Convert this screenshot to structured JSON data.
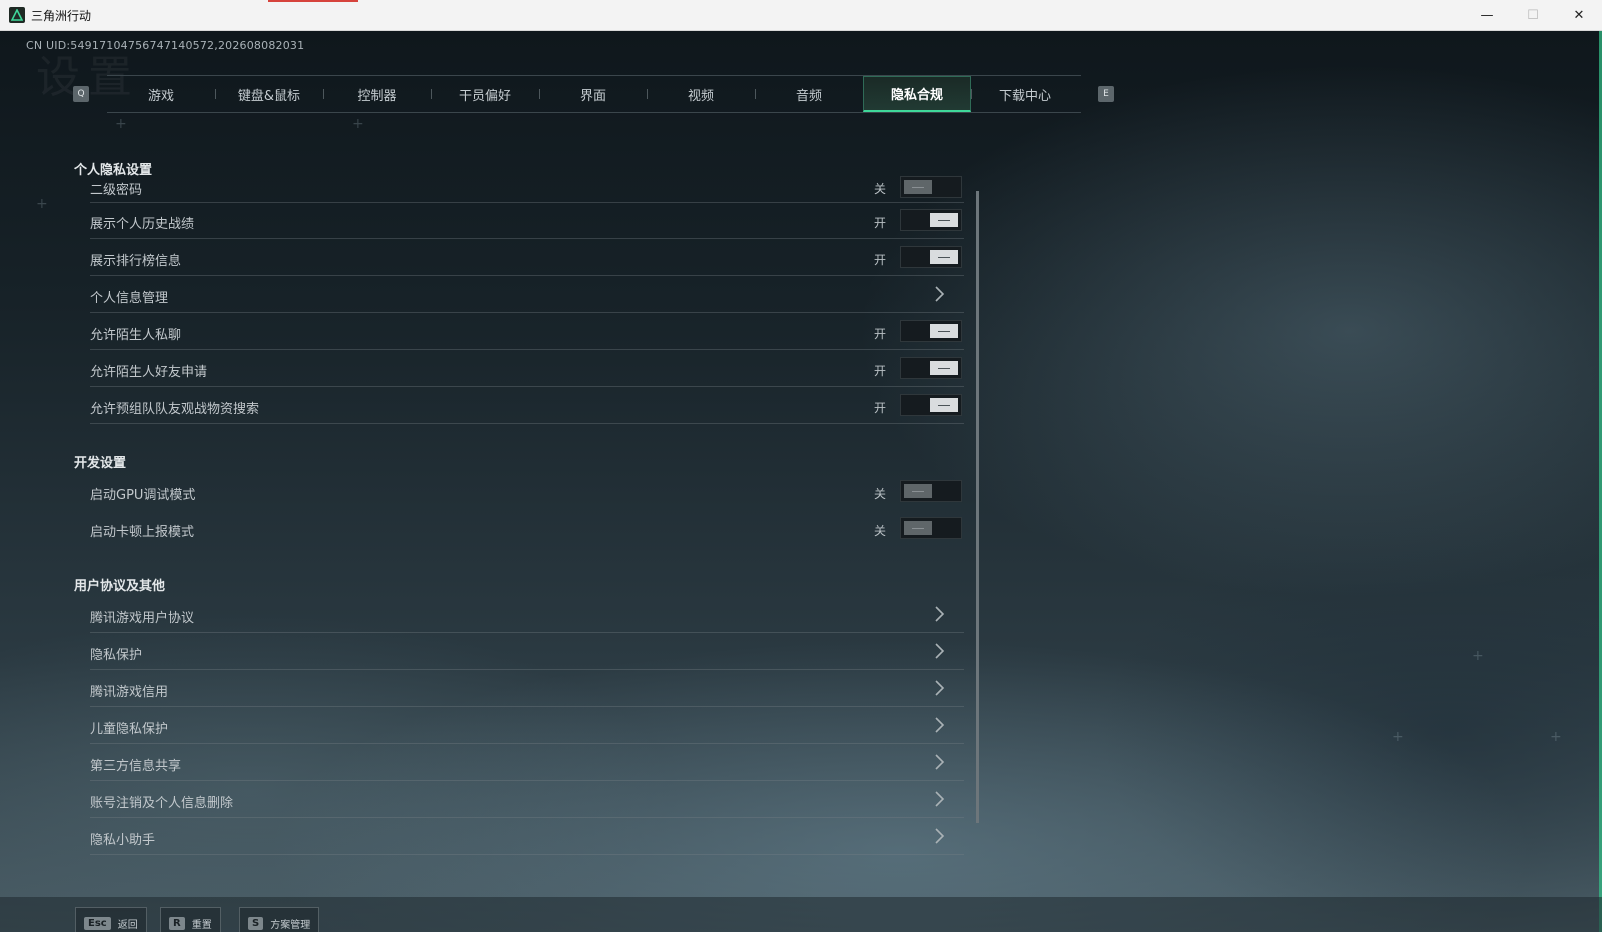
{
  "window": {
    "title": "三角洲行动",
    "minimize_glyph": "—",
    "maximize_glyph": "☐",
    "close_glyph": "✕",
    "icon": "delta-logo-icon"
  },
  "uid": "CN UID:54917104756747140572,202608082031",
  "watermark": "设置",
  "tabs": {
    "prev_key": "Q",
    "next_key": "E",
    "items": [
      {
        "label": "游戏"
      },
      {
        "label": "键盘&鼠标"
      },
      {
        "label": "控制器"
      },
      {
        "label": "干员偏好"
      },
      {
        "label": "界面"
      },
      {
        "label": "视频"
      },
      {
        "label": "音频"
      },
      {
        "label": "隐私合规"
      },
      {
        "label": "下载中心"
      }
    ],
    "active_index": 7
  },
  "sections": {
    "privacy": {
      "title": "个人隐私设置",
      "rows": [
        {
          "label": "二级密码",
          "state": "关",
          "on": false
        },
        {
          "label": "展示个人历史战绩",
          "state": "开",
          "on": true
        },
        {
          "label": "展示排行榜信息",
          "state": "开",
          "on": true
        },
        {
          "label": "个人信息管理",
          "link": true
        },
        {
          "label": "允许陌生人私聊",
          "state": "开",
          "on": true
        },
        {
          "label": "允许陌生人好友申请",
          "state": "开",
          "on": true
        },
        {
          "label": "允许预组队队友观战物资搜索",
          "state": "开",
          "on": true
        }
      ]
    },
    "dev": {
      "title": "开发设置",
      "rows": [
        {
          "label": "启动GPU调试模式",
          "state": "关",
          "on": false
        },
        {
          "label": "启动卡顿上报模式",
          "state": "关",
          "on": false
        }
      ]
    },
    "agreements": {
      "title": "用户协议及其他",
      "rows": [
        {
          "label": "腾讯游戏用户协议",
          "link": true
        },
        {
          "label": "隐私保护",
          "link": true
        },
        {
          "label": "腾讯游戏信用",
          "link": true
        },
        {
          "label": "儿童隐私保护",
          "link": true
        },
        {
          "label": "第三方信息共享",
          "link": true
        },
        {
          "label": "账号注销及个人信息删除",
          "link": true
        },
        {
          "label": "隐私小助手",
          "link": true
        }
      ]
    }
  },
  "bottom": {
    "back": {
      "key": "Esc",
      "label": "返回"
    },
    "reset": {
      "key": "R",
      "label": "重置"
    },
    "profiles": {
      "key": "S",
      "label": "方案管理"
    }
  },
  "colors": {
    "accent": "#3fd89a",
    "toggle_on": "#d9dcde",
    "toggle_off": "#5f6669"
  }
}
